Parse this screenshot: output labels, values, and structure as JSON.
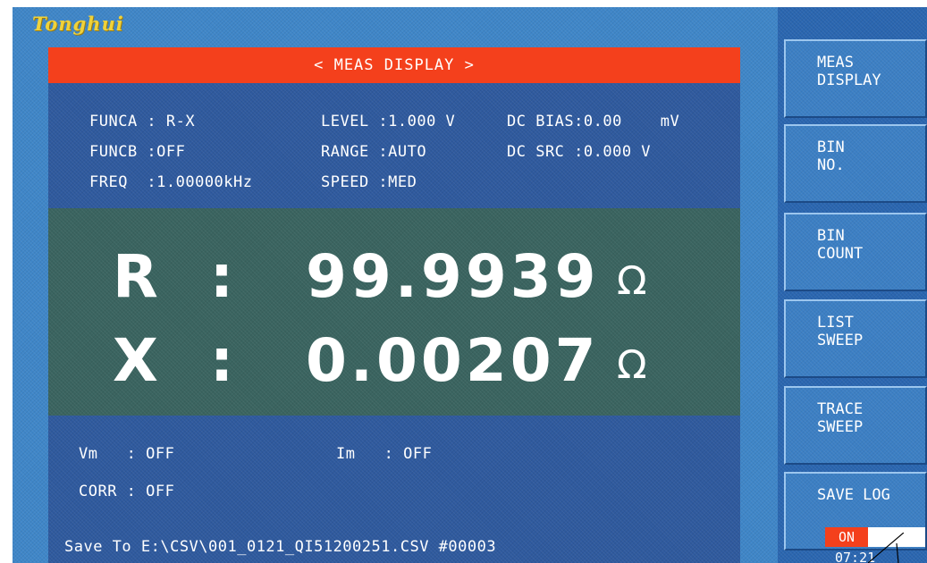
{
  "brand": {
    "logo": "Tonghui"
  },
  "display": {
    "title": "< MEAS DISPLAY >",
    "params": {
      "funca": "FUNCA : R-X",
      "funcb": "FUNCB :OFF",
      "freq": "FREQ  :1.00000kHz",
      "level": "LEVEL :1.000 V",
      "range": "RANGE :AUTO",
      "speed": "SPEED :MED",
      "dc_bias": "DC BIAS:0.00    mV",
      "dc_src": "DC SRC :0.000 V"
    },
    "primary": {
      "label": "R  :",
      "value": "99.9939",
      "unit": "Ω"
    },
    "secondary": {
      "label": "X  :",
      "value": "0.00207",
      "unit": "Ω"
    },
    "monitor": {
      "vm": "Vm   : OFF",
      "im": "Im   : OFF",
      "corr": "CORR : OFF"
    },
    "save_status": "Save To E:\\CSV\\001_0121_QI51200251.CSV #00003"
  },
  "softkeys": [
    {
      "label": "MEAS\nDISPLAY"
    },
    {
      "label": "BIN\nNO."
    },
    {
      "label": "BIN\nCOUNT"
    },
    {
      "label": "LIST\nSWEEP"
    },
    {
      "label": "TRACE\nSWEEP"
    },
    {
      "label": "SAVE LOG",
      "toggle": "ON"
    }
  ],
  "clock": "07:21",
  "colors": {
    "title_bar": "#f4401c",
    "panel": "#2f5a9e",
    "measure_area": "#3a6460",
    "logo": "#f0d23a"
  }
}
